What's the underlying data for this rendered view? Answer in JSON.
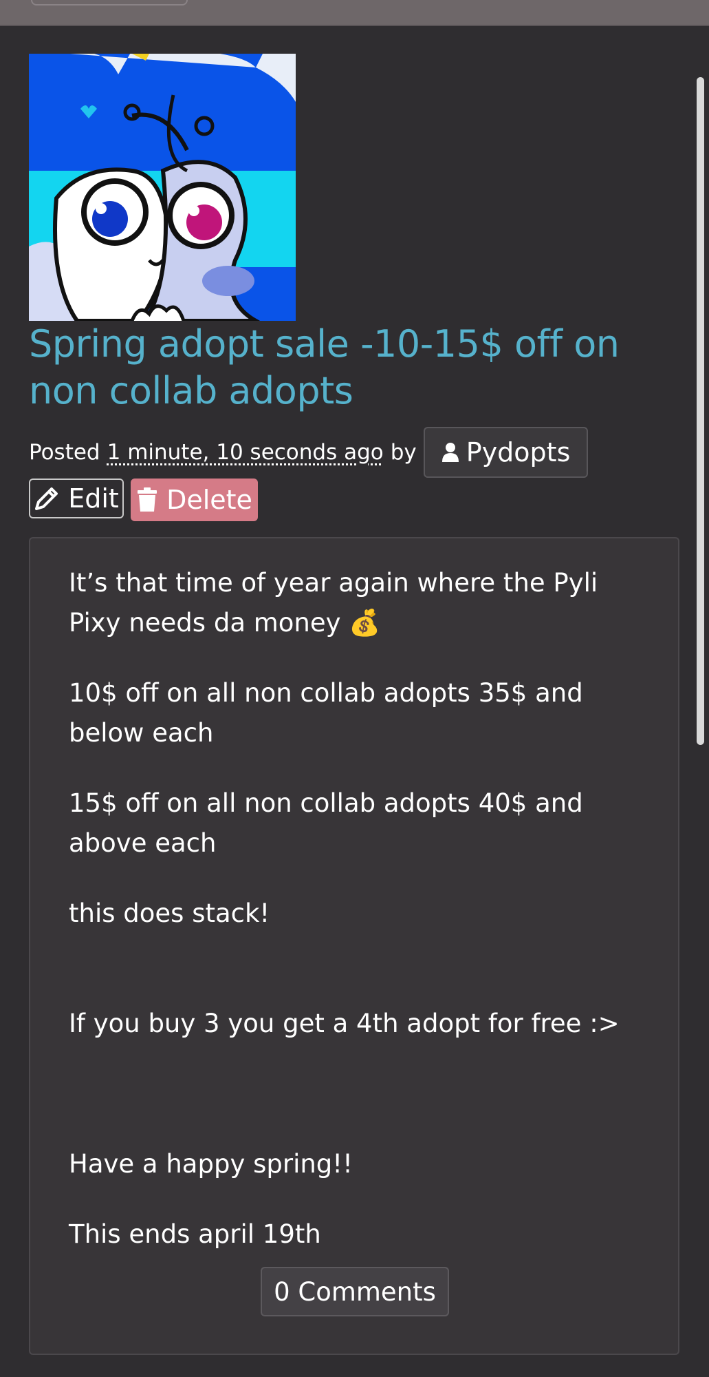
{
  "post": {
    "title": "Spring adopt sale -10-15$ off on non collab adopts",
    "posted_prefix": "Posted",
    "posted_time": "1 minute, 10 seconds ago",
    "posted_by": "by",
    "author": "Pydopts",
    "edit_label": "Edit",
    "delete_label": "Delete",
    "body": [
      "It’s that time of year again where the Pyli Pixy needs da money 💰",
      "10$ off on all non collab adopts 35$ and below each",
      "15$ off on all non collab adopts 40$ and above each",
      "this does stack!",
      "If you buy 3 you get a 4th adopt for free :>",
      "Have a happy spring!!",
      "This ends april 19th"
    ],
    "comments_label": "0 Comments"
  },
  "colors": {
    "background": "#2f2d30",
    "title": "#56b2cc",
    "delete": "#d57b87",
    "card": "#383538"
  },
  "icons": [
    "user-icon",
    "pencil-icon",
    "trash-icon"
  ]
}
